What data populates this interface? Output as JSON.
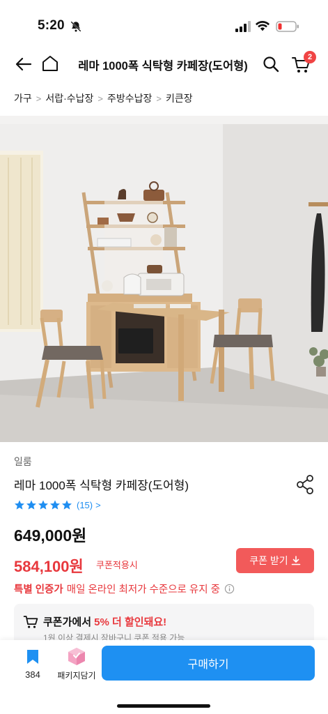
{
  "status_bar": {
    "time": "5:20"
  },
  "header": {
    "title": "레마 1000폭 식탁형 카페장(도어형)",
    "cart_count": "2"
  },
  "breadcrumb": [
    "가구",
    "서랍·수납장",
    "주방수납장",
    "키큰장"
  ],
  "product": {
    "brand": "일룸",
    "name": "레마 1000폭 식탁형 카페장(도어형)",
    "rating": 5,
    "review_count": "(15)",
    "original_price": "649,000원",
    "sale_price": "584,100원",
    "sale_note": "쿠폰적용시",
    "coupon_button": "쿠폰 받기",
    "promo_strong": "특별 인증가",
    "promo_text": "매일 온라인 최저가 수준으로 유지 중"
  },
  "coupon_box": {
    "title_prefix": "쿠폰가에서 ",
    "title_pct": "5% 더 할인돼요!",
    "subtitle": "1원 이상 결제시 장바구니 쿠폰 적용 가능"
  },
  "bottom_bar": {
    "wish_count": "384",
    "package_label": "패키지담기",
    "buy_label": "구매하기"
  },
  "colors": {
    "accent_blue": "#1e90f2",
    "sale_red": "#e8383d",
    "badge_red": "#f04444"
  }
}
